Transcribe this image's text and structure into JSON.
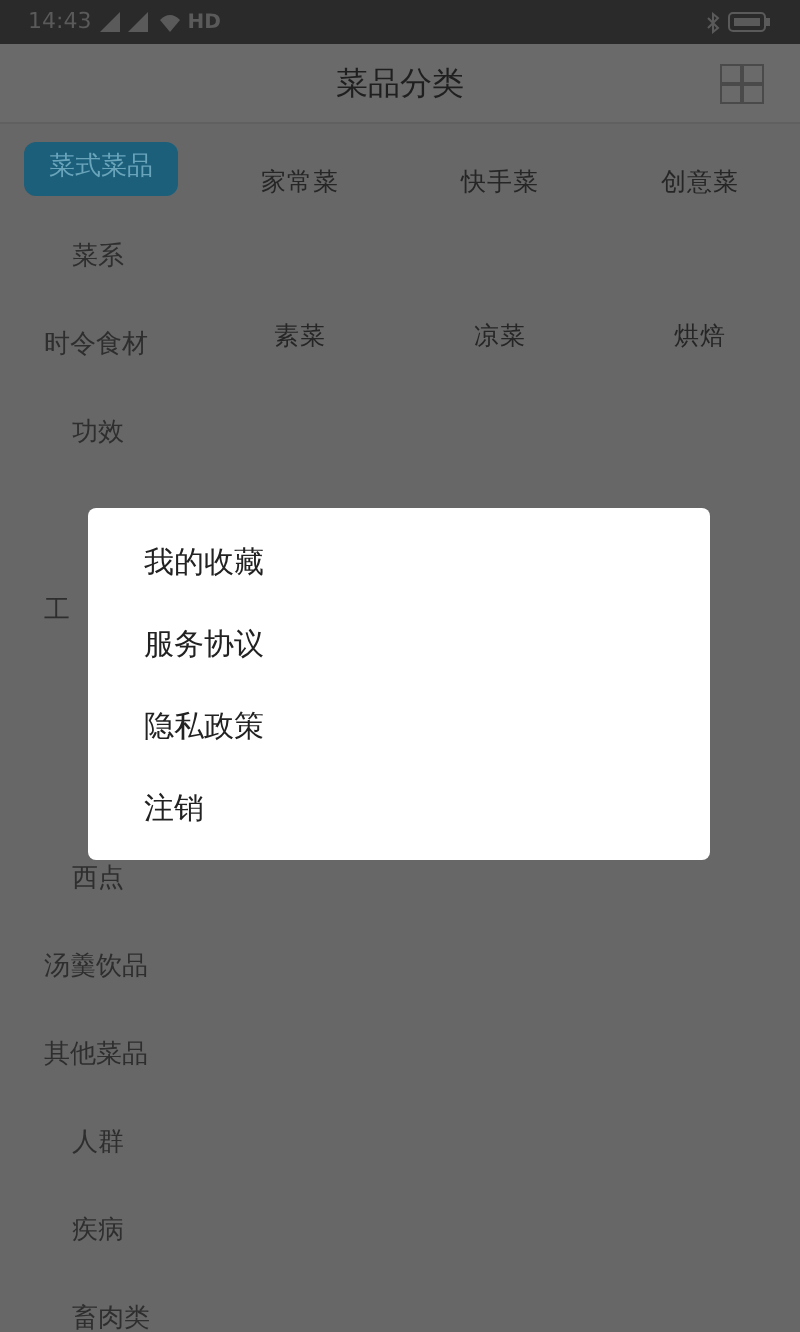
{
  "status_bar": {
    "time": "14:43",
    "network": "HD"
  },
  "header": {
    "title": "菜品分类"
  },
  "sidebar": {
    "items": [
      {
        "kind": "group",
        "label": "菜式菜品",
        "selected": true
      },
      {
        "kind": "sub",
        "label": "菜系",
        "selected": false
      },
      {
        "kind": "group",
        "label": "时令食材",
        "selected": false
      },
      {
        "kind": "sub",
        "label": "功效",
        "selected": false
      },
      {
        "kind": "covered"
      },
      {
        "kind": "group",
        "label": "工",
        "selected": false
      },
      {
        "kind": "covered"
      },
      {
        "kind": "covered"
      },
      {
        "kind": "sub",
        "label": "西点",
        "selected": false
      },
      {
        "kind": "group",
        "label": "汤羹饮品",
        "selected": false
      },
      {
        "kind": "group",
        "label": "其他菜品",
        "selected": false
      },
      {
        "kind": "sub",
        "label": "人群",
        "selected": false
      },
      {
        "kind": "sub",
        "label": "疾病",
        "selected": false
      },
      {
        "kind": "sub",
        "label": "畜肉类",
        "selected": false
      }
    ]
  },
  "categories": [
    {
      "label": "家常菜"
    },
    {
      "label": "快手菜"
    },
    {
      "label": "创意菜"
    },
    {
      "label": "素菜"
    },
    {
      "label": "凉菜"
    },
    {
      "label": "烘焙"
    }
  ],
  "menu": {
    "items": [
      {
        "label": "我的收藏"
      },
      {
        "label": "服务协议"
      },
      {
        "label": "隐私政策"
      },
      {
        "label": "注销"
      }
    ]
  }
}
